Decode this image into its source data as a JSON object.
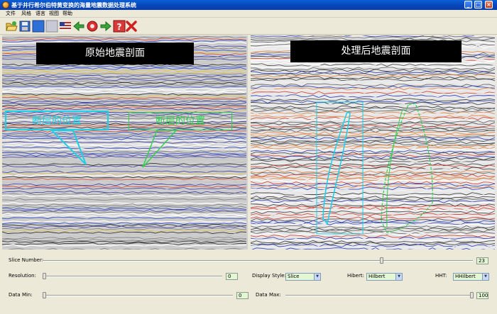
{
  "window": {
    "title": "基于井行希尔伯特黄变换的海量地震数据处理系统"
  },
  "menu": [
    "文件",
    "风格",
    "语言",
    "视图",
    "帮助"
  ],
  "toolbar": {
    "icons": [
      "open-folder-icon",
      "save-disk-icon",
      "blue-square-icon",
      "gray-square-icon",
      "us-flag-icon",
      "back-arrow-icon",
      "red-circle-icon",
      "forward-arrow-icon",
      "help-icon",
      "exit-cross-icon"
    ]
  },
  "panels": {
    "left": {
      "title": "原始地震剖面"
    },
    "right": {
      "title": "处理后地震剖面"
    }
  },
  "annotations": {
    "cyan_label": "断层的位置",
    "green_label": "断层的位置",
    "cyan_color": "#1ed0e6",
    "green_color": "#30d050"
  },
  "controls": {
    "slice_number": {
      "label": "Slice Number:",
      "value": "23",
      "fraction": 0.79
    },
    "resolution": {
      "label": "Resolution:",
      "value": "0",
      "fraction": 0.0
    },
    "display_style": {
      "label": "Display Style:",
      "value": "Slice"
    },
    "hibert": {
      "label": "Hibert:",
      "value": "Hilbert"
    },
    "hht": {
      "label": "HHT:",
      "value": "HHilbert"
    },
    "data_min": {
      "label": "Data Min:",
      "value": "0",
      "fraction": 0.0
    },
    "data_max": {
      "label": "Data Max:",
      "value": "100",
      "fraction": 1.0
    }
  }
}
